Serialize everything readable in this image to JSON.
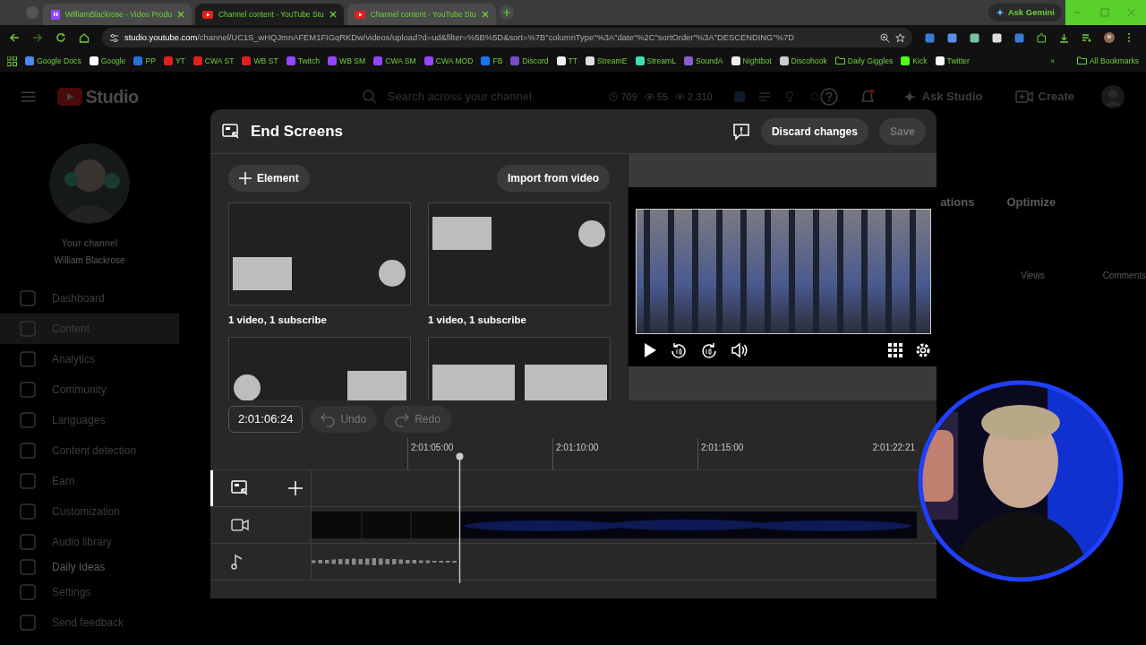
{
  "browser": {
    "tabs": [
      {
        "kind": "twitch",
        "title": "WilliamBlackrose - Video Produ",
        "selected": false
      },
      {
        "kind": "youtube",
        "title": "Channel content - YouTube Stu",
        "selected": true
      },
      {
        "kind": "youtube",
        "title": "Channel content - YouTube Stu",
        "selected": false
      }
    ],
    "ask_gemini": "Ask Gemini",
    "address": {
      "host": "studio.youtube.com",
      "path": "/channel/UC1S_wHQJmnAFEM1FIGqRKDw/videos/upload?d=ud&filter=%5B%5D&sort=%7B\"columnType\"%3A\"date\"%2C\"sortOrder\"%3A\"DESCENDING\"%7D"
    },
    "bookmarks": [
      {
        "kind": "site",
        "label": "Google Docs",
        "color": "#4a8af4"
      },
      {
        "kind": "site",
        "label": "Google",
        "color": "#ffffff"
      },
      {
        "kind": "site",
        "label": "PP",
        "color": "#2a6fd6"
      },
      {
        "kind": "site",
        "label": "YT",
        "color": "#e02020"
      },
      {
        "kind": "site",
        "label": "CWA ST",
        "color": "#e02020"
      },
      {
        "kind": "site",
        "label": "WB ST",
        "color": "#e02020"
      },
      {
        "kind": "site",
        "label": "Twitch",
        "color": "#9146ff"
      },
      {
        "kind": "site",
        "label": "WB SM",
        "color": "#9146ff"
      },
      {
        "kind": "site",
        "label": "CWA SM",
        "color": "#9146ff"
      },
      {
        "kind": "site",
        "label": "CWA MOD",
        "color": "#9146ff"
      },
      {
        "kind": "site",
        "label": "FB",
        "color": "#1877f2"
      },
      {
        "kind": "site",
        "label": "Discord",
        "color": "#7a4cc8"
      },
      {
        "kind": "site",
        "label": "TT",
        "color": "#f0f0f0"
      },
      {
        "kind": "site",
        "label": "StreamE",
        "color": "#dddddd"
      },
      {
        "kind": "site",
        "label": "StreamL",
        "color": "#3ee0b0"
      },
      {
        "kind": "site",
        "label": "SoundA",
        "color": "#8a5cd0"
      },
      {
        "kind": "site",
        "label": "Nightbot",
        "color": "#eeeeee"
      },
      {
        "kind": "site",
        "label": "Discohook",
        "color": "#cccccc"
      },
      {
        "kind": "folder",
        "label": "Daily Giggles"
      },
      {
        "kind": "site",
        "label": "Kick",
        "color": "#53fc18"
      },
      {
        "kind": "site",
        "label": "Twitter",
        "color": "#fafafa"
      }
    ],
    "more": "»",
    "all_bookmarks": "All Bookmarks"
  },
  "studio": {
    "logo": "Studio",
    "search": {
      "placeholder": "Search across your channel"
    },
    "stats": [
      {
        "kind": "clock",
        "value": "709"
      },
      {
        "kind": "eye",
        "value": "55"
      },
      {
        "kind": "eye",
        "value": "2,310"
      }
    ],
    "ask_studio": "Ask Studio",
    "create": "Create",
    "channel": {
      "caption": "Your channel",
      "name": "William Blackrose"
    },
    "nav": [
      {
        "label": "Dashboard",
        "selected": false
      },
      {
        "label": "Content",
        "selected": true
      },
      {
        "label": "Analytics",
        "selected": false
      },
      {
        "label": "Community",
        "selected": false
      },
      {
        "label": "Languages",
        "selected": false
      },
      {
        "label": "Content detection",
        "selected": false
      },
      {
        "label": "Earn",
        "selected": false
      },
      {
        "label": "Customization",
        "selected": false
      },
      {
        "label": "Audio library",
        "selected": false
      },
      {
        "label": "Daily Ideas",
        "selected": false
      }
    ],
    "footer_nav": [
      "Settings",
      "Send feedback"
    ],
    "background_tabs": [
      "ations",
      "Optimize"
    ],
    "background_columns": [
      "Views",
      "Comments"
    ]
  },
  "end_screens": {
    "title": "End Screens",
    "discard": "Discard changes",
    "save": {
      "label": "Save",
      "disabled": true
    },
    "add_element": "Element",
    "import": "Import from video",
    "templates": [
      {
        "kind": "a",
        "label": "1 video, 1 subscribe"
      },
      {
        "kind": "b",
        "label": "1 video, 1 subscribe"
      },
      {
        "kind": "c"
      },
      {
        "kind": "d"
      }
    ],
    "timecode": "2:01:06:24",
    "undo": {
      "label": "Undo",
      "disabled": true
    },
    "redo": {
      "label": "Redo",
      "disabled": true
    },
    "ruler": [
      "2:01:05:00",
      "2:01:10:00",
      "2:01:15:00",
      "2:01:22:21"
    ],
    "tracks": [
      {
        "kind": "endscreen",
        "selected": true
      },
      {
        "kind": "video",
        "selected": false
      },
      {
        "kind": "audio",
        "selected": false
      }
    ]
  }
}
